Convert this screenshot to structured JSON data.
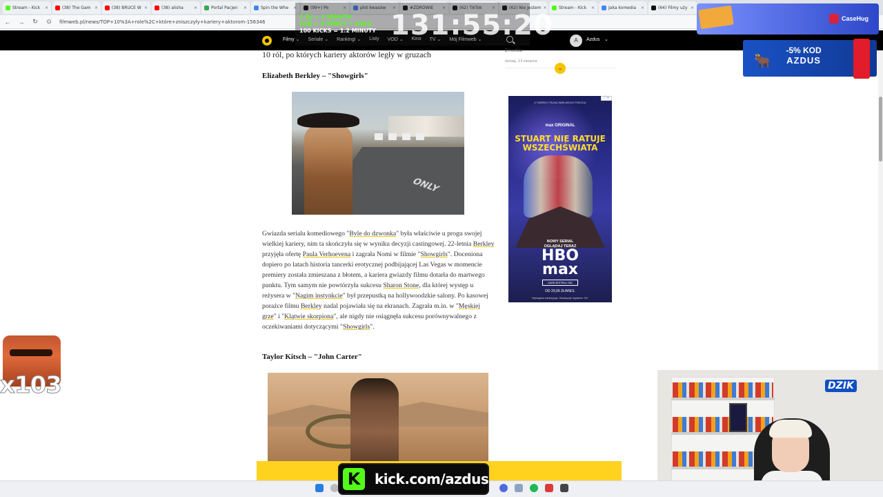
{
  "browser": {
    "tabs": [
      {
        "label": "Stream - Kick",
        "color": "#53fc18"
      },
      {
        "label": "(38) The Gam",
        "color": "#ff0000"
      },
      {
        "label": "(38) BRUCE W",
        "color": "#ff0000"
      },
      {
        "label": "(38) alisha",
        "color": "#ff0000"
      },
      {
        "label": "Portal Pacjen",
        "color": "#35a853"
      },
      {
        "label": "Spin the Whe",
        "color": "#4285f4"
      },
      {
        "label": "(99+) Po",
        "color": "#111111"
      },
      {
        "label": "plot kwasów",
        "color": "#4285f4"
      },
      {
        "label": "#ZDROWIE",
        "color": "#111111"
      },
      {
        "label": "(62) TikTok",
        "color": "#111111"
      },
      {
        "label": "(62) Nie jestem",
        "color": "#111111"
      },
      {
        "label": "Stream - Kick",
        "color": "#53fc18"
      },
      {
        "label": "Jaka komedia",
        "color": "#4285f4"
      },
      {
        "label": "(64) Filmy uży",
        "color": "#111111"
      }
    ],
    "url": "filmweb.pl/news/TOP+10%3A+role%2C+które+zniszczyły+kariery+aktorom-156346"
  },
  "site": {
    "nav": [
      "Filmy",
      "Seriale",
      "Rankingi",
      "Listy",
      "VOD",
      "Kino",
      "TV",
      "Mój Filmweb"
    ],
    "user_initial": "A",
    "username": "Azdus"
  },
  "overlay": {
    "donations": [
      "2 ZŁ = 1 MINUTA",
      "SUB = 8 MINUT + KOŁO",
      "100 KICKS = 1.2 MINUTY"
    ],
    "timer": "131:55:20",
    "casehug": "CaseHug",
    "dzik_discount": "-5% KOD",
    "dzik_code": "AZDUS",
    "emote_count": "x103",
    "dzik_logo": "DZIK",
    "kick_url": "kick.com/azdus",
    "kick_k": "K"
  },
  "article": {
    "prev_title": "10 ról, po których kariery aktorów legły w gruzach",
    "heading1": "Elizabeth Berkley – \"Showgirls\"",
    "paragraph_segments": [
      {
        "t": "Gwiazda serialu komediowego \"",
        "link": false
      },
      {
        "t": "Byle do dzwonka",
        "link": true
      },
      {
        "t": "\" była właściwie u progu swojej wielkiej kariery, nim ta skończyła się w wyniku decyzji castingowej. 22-letnia ",
        "link": false
      },
      {
        "t": "Berkley",
        "link": true
      },
      {
        "t": " przyjęła ofertę ",
        "link": false
      },
      {
        "t": "Paula Verhoevena",
        "link": true
      },
      {
        "t": " i zagrała Nomi w filmie \"",
        "link": false
      },
      {
        "t": "Showgirls",
        "link": true
      },
      {
        "t": "\". Doceniona dopiero po latach historia tancerki erotycznej podbijającej Las Vegas w momencie premiery została zmieszana z błotem, a kariera gwiazdy filmu dotarła do martwego punktu. Tym samym nie powtórzyła sukcesu ",
        "link": false
      },
      {
        "t": "Sharon Stone",
        "link": true
      },
      {
        "t": ", dla której występ u reżysera w \"",
        "link": false
      },
      {
        "t": "Nagim instynkcie",
        "link": true
      },
      {
        "t": "\" był przepustką na hollywoodzkie salony. Po kasowej porażce filmu ",
        "link": false
      },
      {
        "t": "Berkley",
        "link": true
      },
      {
        "t": " nadal pojawiała się na ekranach. Zagrała m.in. w \"",
        "link": false
      },
      {
        "t": "Męskiej grze",
        "link": true
      },
      {
        "t": "\" i \"",
        "link": false
      },
      {
        "t": "Klątwie skorpiona",
        "link": true
      },
      {
        "t": "\", ale nigdy nie osiągnęła sukcesu porównywalnego z oczekiwaniami dotyczącymi \"",
        "link": false
      },
      {
        "t": "Showgirls",
        "link": true
      },
      {
        "t": "\".",
        "link": false
      }
    ],
    "heading2": "Taylor Kitsch – \"John Carter\"",
    "photo1_road_text": "ONLY"
  },
  "sidebar": {
    "item_title": "Zmorbie",
    "item_date": "dzisiaj, 13 sierpnia",
    "ad": {
      "tag": "Z TWÓRCY FILMU WIELKIEGO POKOJU",
      "brand": "max ORIGINAL",
      "title_line1": "STUART NIE RATUJE",
      "title_line2": "WSZECHŚWIATA",
      "subtitle_line1": "NOWY SERIAL",
      "subtitle_line2": "OGLĄDAJ TERAZ",
      "logo_line1": "HBO",
      "logo_line2": "max",
      "button": "ZAREJESTRUJ SIĘ",
      "price": "OD 29,99 ZŁ/MIES.",
      "footer": "Wymagana subskrypcja. Obowiązuje regulamin. 16+"
    }
  }
}
